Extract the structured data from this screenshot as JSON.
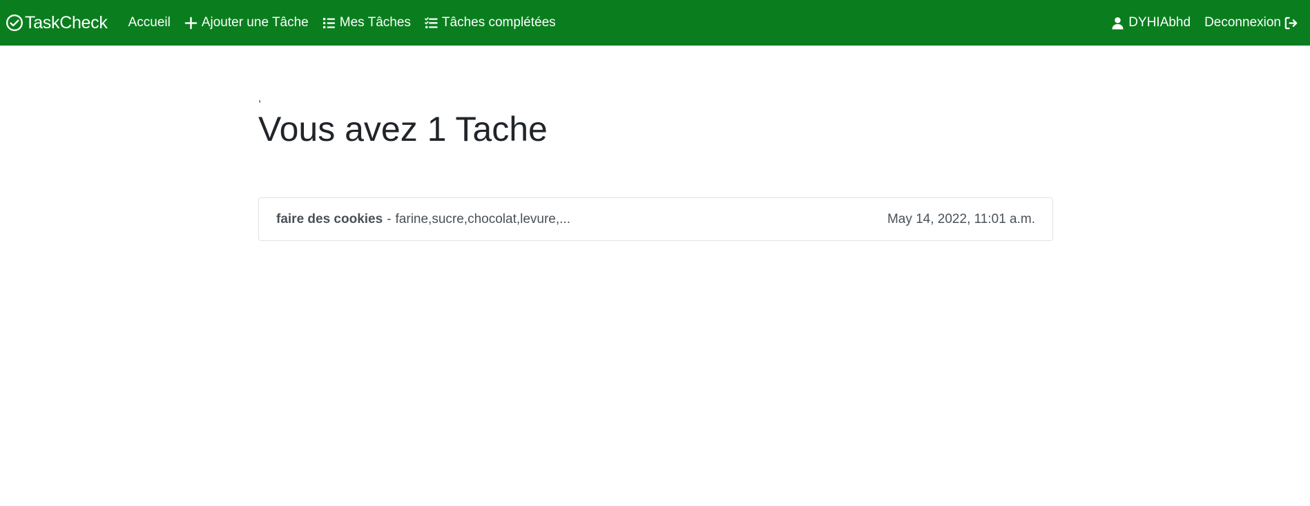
{
  "navbar": {
    "brand": "TaskCheck",
    "items": [
      {
        "label": "Accueil",
        "icon": ""
      },
      {
        "label": "Ajouter une Tâche",
        "icon": "plus-icon"
      },
      {
        "label": "Mes Tâches",
        "icon": "list-icon"
      },
      {
        "label": "Tâches complétées",
        "icon": "checklist-icon"
      }
    ],
    "user": {
      "label": "DYHIAbhd",
      "icon": "user-icon"
    },
    "logout": {
      "label": "Deconnexion",
      "icon": "logout-icon"
    },
    "bg_color": "#0a7e1e"
  },
  "main": {
    "tick": ",",
    "title": "Vous avez 1 Tache",
    "tasks": [
      {
        "title": "faire des cookies",
        "separator": "-",
        "description": "farine,sucre,chocolat,levure,...",
        "date": "May 14, 2022, 11:01 a.m."
      }
    ]
  }
}
